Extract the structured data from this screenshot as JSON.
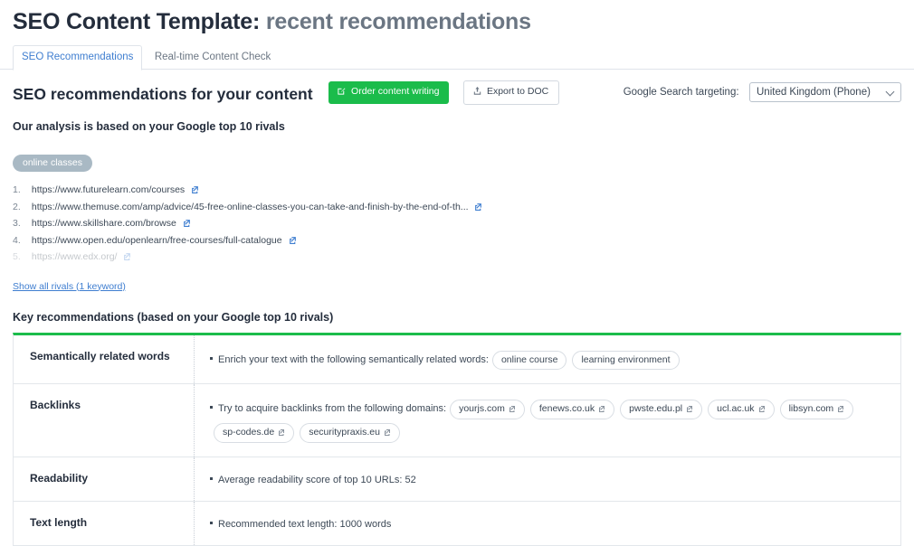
{
  "header": {
    "title_main": "SEO Content Template:",
    "title_sub": "recent recommendations"
  },
  "tabs": [
    {
      "label": "SEO Recommendations",
      "active": true
    },
    {
      "label": "Real-time Content Check",
      "active": false
    }
  ],
  "action_bar": {
    "section_title": "SEO recommendations for your content",
    "order_button": "Order content writing",
    "order_icon": "compose-icon",
    "export_button": "Export to DOC",
    "export_icon": "export-upload-icon",
    "targeting_label": "Google Search targeting:",
    "targeting_value": "United Kingdom (Phone)",
    "targeting_chevron": "chevron-down-icon"
  },
  "analysis": {
    "subtitle": "Our analysis is based on your Google top 10 rivals",
    "keyword_tag": "online classes",
    "rivals": [
      {
        "url": "https://www.futurelearn.com/courses",
        "faded": false
      },
      {
        "url": "https://www.themuse.com/amp/advice/45-free-online-classes-you-can-take-and-finish-by-the-end-of-th...",
        "faded": false
      },
      {
        "url": "https://www.skillshare.com/browse",
        "faded": false
      },
      {
        "url": "https://www.open.edu/openlearn/free-courses/full-catalogue",
        "faded": false
      },
      {
        "url": "https://www.edx.org/",
        "faded": true
      }
    ],
    "show_all_link": "Show all rivals (1 keyword)"
  },
  "recommendations": {
    "heading": "Key recommendations (based on your Google top 10 rivals)",
    "rows": [
      {
        "label": "Semantically related words",
        "text": "Enrich your text with the following semantically related words:",
        "chips": [
          {
            "text": "online course",
            "external": false
          },
          {
            "text": "learning environment",
            "external": false
          }
        ]
      },
      {
        "label": "Backlinks",
        "text": "Try to acquire backlinks from the following domains:",
        "chips": [
          {
            "text": "yourjs.com",
            "external": true
          },
          {
            "text": "fenews.co.uk",
            "external": true
          },
          {
            "text": "pwste.edu.pl",
            "external": true
          },
          {
            "text": "ucl.ac.uk",
            "external": true
          },
          {
            "text": "libsyn.com",
            "external": true
          },
          {
            "text": "sp-codes.de",
            "external": true
          },
          {
            "text": "securitypraxis.eu",
            "external": true
          }
        ]
      },
      {
        "label": "Readability",
        "text": "Average readability score of top 10 URLs:  52",
        "chips": []
      },
      {
        "label": "Text length",
        "text": "Recommended text length: 1000 words",
        "chips": []
      }
    ]
  },
  "colors": {
    "accent_green": "#1bbc4b",
    "link_blue": "#3f7ed0",
    "tag_gray": "#a9b9c4",
    "text_dark": "#242d3c"
  }
}
